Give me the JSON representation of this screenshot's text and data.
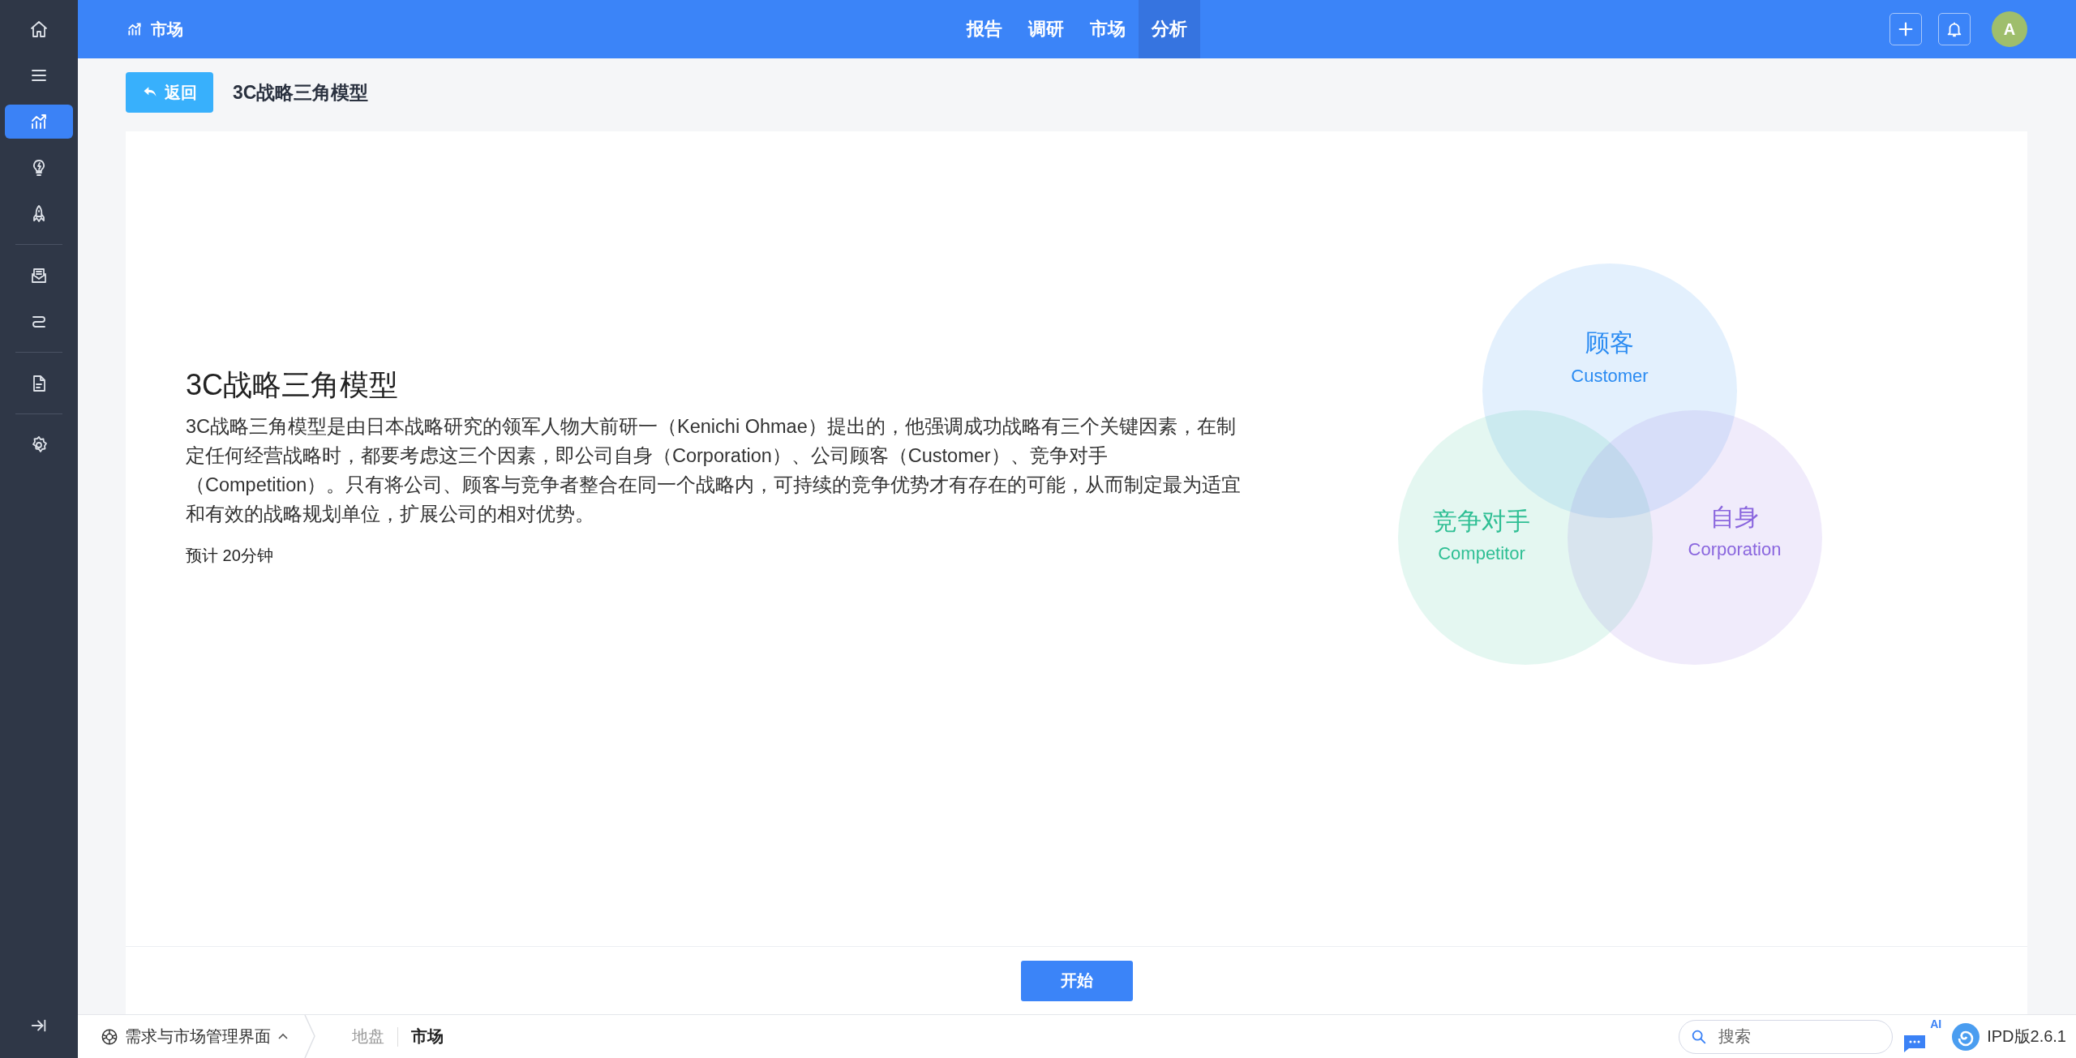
{
  "sidebar": {
    "groups": [
      [
        {
          "selected": false
        },
        {
          "selected": false
        },
        {
          "selected": true
        },
        {
          "selected": false
        },
        {
          "selected": false
        }
      ],
      [
        {
          "selected": false
        },
        {
          "selected": false
        }
      ],
      [
        {
          "selected": false
        }
      ],
      [
        {
          "selected": false
        }
      ]
    ]
  },
  "header": {
    "title": "市场",
    "tabs": [
      {
        "label": "报告",
        "selected": false
      },
      {
        "label": "调研",
        "selected": false
      },
      {
        "label": "市场",
        "selected": false
      },
      {
        "label": "分析",
        "selected": true
      }
    ],
    "avatar": "A"
  },
  "page": {
    "back_button": "返回",
    "title": "3C战略三角模型"
  },
  "intro": {
    "heading": "3C战略三角模型",
    "description": "3C战略三角模型是由日本战略研究的领军人物大前研一（Kenichi Ohmae）提出的，他强调成功战略有三个关键因素，在制定任何经营战略时，都要考虑这三个因素，即公司自身（Corporation）、公司顾客（Customer）、竞争对手（Competition）。只有将公司、顾客与竞争者整合在同一个战略内，可持续的竞争优势才有存在的可能，从而制定最为适宜和有效的战略规划单位，扩展公司的相对优势。",
    "duration": "预计 20分钟"
  },
  "venn": {
    "circles": [
      {
        "title": "顾客",
        "subtitle": "Customer",
        "color": "#2a8bf2"
      },
      {
        "title": "竞争对手",
        "subtitle": "Competitor",
        "color": "#2fbf94"
      },
      {
        "title": "自身",
        "subtitle": "Corporation",
        "color": "#8a66de"
      }
    ]
  },
  "start_button": "开始",
  "status_bar": {
    "module": "需求与市场管理界面",
    "breadcrumbs": [
      {
        "label": "地盘",
        "selected": false
      },
      {
        "label": "市场",
        "selected": true
      }
    ],
    "search": {
      "placeholder": "搜索"
    },
    "ai_badge": "AI",
    "version": "IPD版2.6.1"
  }
}
